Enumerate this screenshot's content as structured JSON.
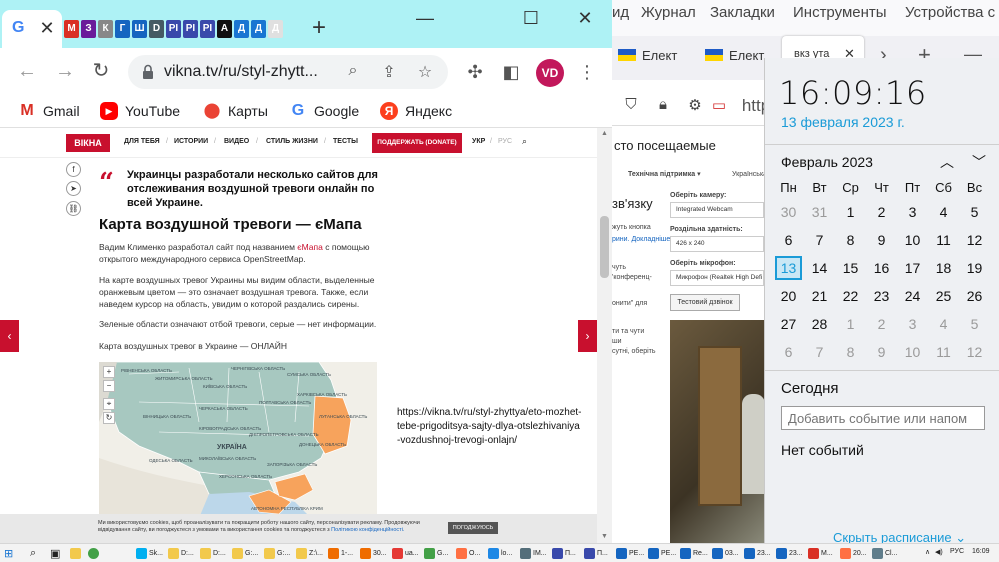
{
  "chrome": {
    "url": "vikna.tv/ru/styl-zhytt...",
    "avatar": "VD",
    "close_glyph": "✕",
    "new_tab": "+",
    "minimize": "—",
    "maximize": "☐",
    "close_win": "✕",
    "mini_tabs": [
      "M",
      "З",
      "К",
      "Г",
      "Ш",
      "D",
      "РІ",
      "РІ",
      "РІ",
      "А",
      "Д",
      "Д",
      "Д"
    ],
    "mini_tab_colors": [
      "#d93025",
      "#6a1b9a",
      "#888",
      "#1565c0",
      "#1565c0",
      "#455a64",
      "#3949ab",
      "#3949ab",
      "#3949ab",
      "#111",
      "#1976d2",
      "#1976d2",
      "#e0e0e0"
    ]
  },
  "bookmarks": [
    {
      "label": "Gmail",
      "icon": "gmail-icon",
      "glyph": "M",
      "color": "#d93025"
    },
    {
      "label": "YouTube",
      "icon": "youtube-icon",
      "glyph": "▶",
      "color": "#ff0000"
    },
    {
      "label": "Карты",
      "icon": "maps-icon",
      "glyph": "⬤",
      "color": "#34a853"
    },
    {
      "label": "Google",
      "icon": "google-icon",
      "glyph": "G",
      "color": "#4285f4"
    },
    {
      "label": "Яндекс",
      "icon": "yandex-icon",
      "glyph": "Я",
      "color": "#fc3f1d"
    }
  ],
  "site": {
    "logo": "ВІКНА",
    "nav": [
      "ДЛЯ ТЕБЯ",
      "ИСТОРИИ",
      "ВИДЕО",
      "СТИЛЬ ЖИЗНИ",
      "ТЕСТЫ"
    ],
    "donate": "ПОДДЕРЖАТЬ (DONATE)",
    "lang_ukr": "УКР",
    "lang_rus": "РУС",
    "lead": "Украинцы разработали несколько сайтов для отслеживания воздушной тревоги онлайн по всей Украине.",
    "heading": "Карта воздушной тревоги — єМапа",
    "p1_a": "Вадим Клименко разработал сайт под названием ",
    "p1_link": "єМапа",
    "p1_b": " с помощью открытого международного сервиса OpenStreetMap.",
    "p2": "На карте воздушных тревог Украины мы видим области, выделенные оранжевым цветом — это означает воздушная тревога. Также, если наведем курсор на область, увидим о которой раздались сирены.",
    "p3": "Зеленые области означают отбой тревоги, серые — нет информации.",
    "p4": "Карта воздушных тревог в Украине — ОНЛАЙН",
    "map_labels": [
      "РІВНЕНСЬКА ОБЛАСТЬ",
      "ЖИТОМИРСЬКА ОБЛАСТЬ",
      "КИЇВСЬКА ОБЛАСТЬ",
      "ЧЕРНІГІВСЬКА ОБЛАСТЬ",
      "СУМСЬКА ОБЛАСТЬ",
      "ПОЛТАВСЬКА ОБЛАСТЬ",
      "ХАРКІВСЬКА ОБЛАСТЬ",
      "ЛУГАНСЬКА ОБЛАСТЬ",
      "ЧЕРКАСЬКА ОБЛАСТЬ",
      "КІРОВОГРАДСЬКА ОБЛАСТЬ",
      "ДНІПРОПЕТРОВСЬКА ОБЛАСТЬ",
      "ДОНЕЦЬКА ОБЛАСТЬ",
      "ВІННИЦЬКА ОБЛАСТЬ",
      "ОДЕСЬКА ОБЛАСТЬ",
      "МИКОЛАЇВСЬКА ОБЛАСТЬ",
      "ХЕРСОНСЬКА ОБЛАСТЬ",
      "ЗАПОРІЗЬКА ОБЛАСТЬ",
      "УКРАЇНА",
      "АВТОНОМНА РЕСПУБЛІКА КРИМ"
    ],
    "url_annotation": "https://vikna.tv/ru/styl-zhyttya/eto-mozhet-tebe-prigoditsya-sajty-dlya-otslezhivaniya-vozdushnoj-trevogi-onlajn/",
    "cookie_text": "Ми використовуємо cookies, щоб проаналізувати та покращити роботу нашого сайту, персоналізувати рекламу. Продовжуючи відвідування сайту, ви погоджуєтеся з умовами та використання cookies та погоджуєтеся з ",
    "cookie_link": "Політикою конфіденційності.",
    "cookie_btn": "ПОГОДЖУЮСЬ",
    "colors": {
      "accent": "#c8102e",
      "map_green": "#a7c8c0",
      "map_orange": "#f7a35c",
      "map_water": "#bcd7ea"
    }
  },
  "firefox": {
    "menu": [
      "ид",
      "Журнал",
      "Закладки",
      "Инструменты",
      "Устройства с"
    ],
    "tab1": "Елект",
    "tab2": "Елект",
    "active_tab": "вкз ута",
    "tab_close": "✕",
    "url_fragment": "http",
    "page": {
      "title": "сто посещаемые",
      "support": "Технічна підтримка ▾",
      "lang_sel": "Українська ▾",
      "camera_label": "Оберіть камеру:",
      "camera": "Integrated Webcam",
      "res_label": "Роздільна здатність:",
      "resolution": "426 x 240",
      "mic_label": "Оберіть мікрофон:",
      "mic": "Микрофон (Realtek High Defi",
      "test_call": "Тестовий дзвінок",
      "left1": "зв'язку",
      "left2": "жуть кнопка",
      "left3": "рини. Докладніше",
      "left4": "чуть",
      "left5": "'конференц-",
      "left6": "онити\" для",
      "left7": "ти та чути",
      "left8": "ши",
      "left9": "сутні, оберіть"
    }
  },
  "clock": {
    "time": "16:09:16",
    "date": "13 февраля 2023 г.",
    "month": "Февраль 2023",
    "dow": [
      "Пн",
      "Вт",
      "Ср",
      "Чт",
      "Пт",
      "Сб",
      "Вс"
    ],
    "weeks": [
      [
        "30",
        "31",
        "1",
        "2",
        "3",
        "4",
        "5"
      ],
      [
        "6",
        "7",
        "8",
        "9",
        "10",
        "11",
        "12"
      ],
      [
        "13",
        "14",
        "15",
        "16",
        "17",
        "18",
        "19"
      ],
      [
        "20",
        "21",
        "22",
        "23",
        "24",
        "25",
        "26"
      ],
      [
        "27",
        "28",
        "1",
        "2",
        "3",
        "4",
        "5"
      ],
      [
        "6",
        "7",
        "8",
        "9",
        "10",
        "11",
        "12"
      ]
    ],
    "today_label": "Сегодня",
    "event_placeholder": "Добавить событие или напом",
    "no_events": "Нет событий",
    "hide_schedule": "Скрыть расписание ⌄"
  },
  "taskbar": {
    "items": [
      {
        "label": "Sk...",
        "color": "#00aff0"
      },
      {
        "label": "D:...",
        "color": "#f2c94c"
      },
      {
        "label": "D:...",
        "color": "#f2c94c"
      },
      {
        "label": "G:...",
        "color": "#f2c94c"
      },
      {
        "label": "G:...",
        "color": "#f2c94c"
      },
      {
        "label": "Z:\\...",
        "color": "#f2c94c"
      },
      {
        "label": "1-...",
        "color": "#ef6c00"
      },
      {
        "label": "30...",
        "color": "#ef6c00"
      },
      {
        "label": "ua...",
        "color": "#e53935"
      },
      {
        "label": "G...",
        "color": "#43a047"
      },
      {
        "label": "O...",
        "color": "#ff7043"
      },
      {
        "label": "lo...",
        "color": "#1e88e5"
      },
      {
        "label": "IM...",
        "color": "#546e7a"
      },
      {
        "label": "П...",
        "color": "#3949ab"
      },
      {
        "label": "П...",
        "color": "#3949ab"
      },
      {
        "label": "PE...",
        "color": "#1565c0"
      },
      {
        "label": "PE...",
        "color": "#1565c0"
      },
      {
        "label": "Re...",
        "color": "#1565c0"
      },
      {
        "label": "03...",
        "color": "#1565c0"
      },
      {
        "label": "23...",
        "color": "#1565c0"
      },
      {
        "label": "23...",
        "color": "#1565c0"
      },
      {
        "label": "M...",
        "color": "#d93025"
      },
      {
        "label": "20...",
        "color": "#ff7043"
      },
      {
        "label": "Cl...",
        "color": "#607d8b"
      }
    ],
    "lang": "РУС",
    "time": "16:09"
  }
}
